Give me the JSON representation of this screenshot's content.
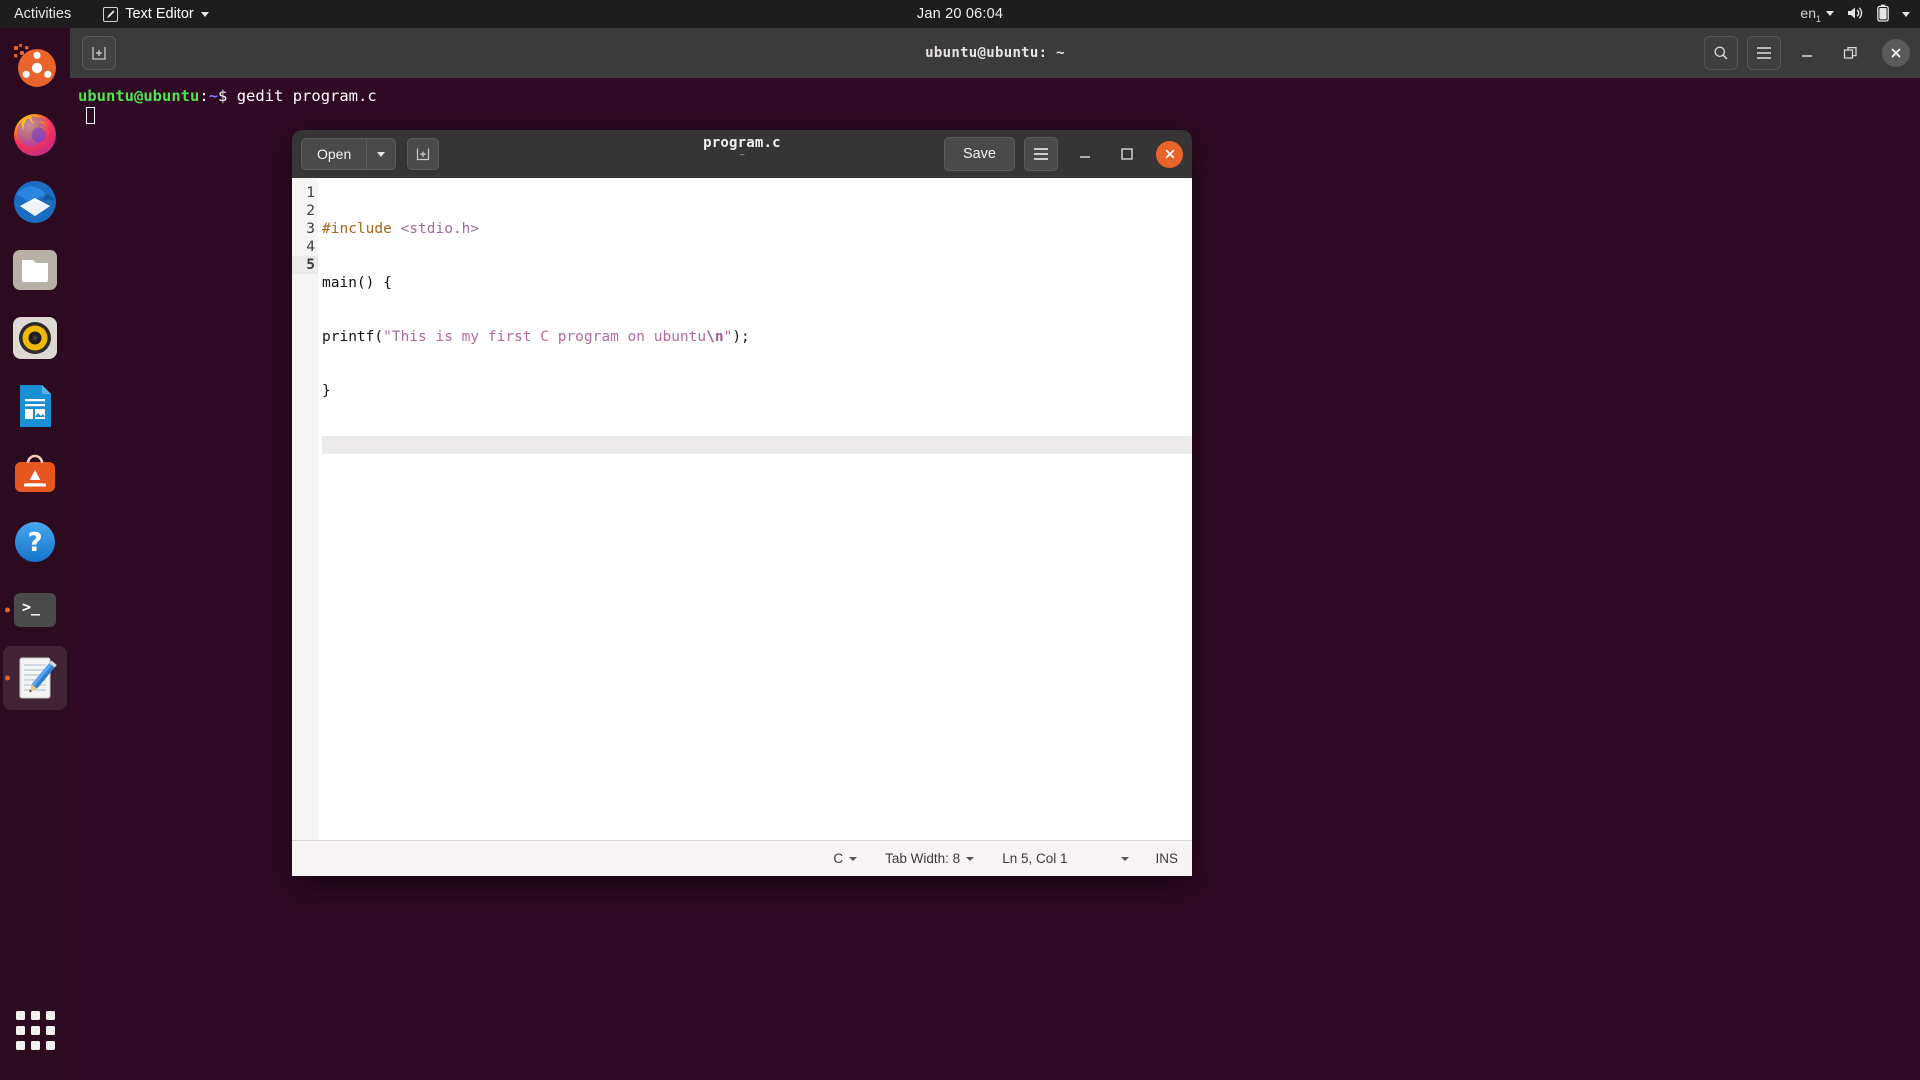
{
  "topbar": {
    "activities": "Activities",
    "app_name": "Text Editor",
    "clock": "Jan 20  06:04",
    "keyboard_layout": "en",
    "keyboard_sub": "1"
  },
  "dock": {
    "items": [
      {
        "name": "ubuntu-software-install",
        "label": "Install Ubuntu",
        "running": false,
        "active": false
      },
      {
        "name": "firefox",
        "label": "Firefox Web Browser",
        "running": false,
        "active": false
      },
      {
        "name": "thunderbird",
        "label": "Thunderbird Mail",
        "running": false,
        "active": false
      },
      {
        "name": "files",
        "label": "Files",
        "running": false,
        "active": false
      },
      {
        "name": "rhythmbox",
        "label": "Rhythmbox",
        "running": false,
        "active": false
      },
      {
        "name": "libreoffice-writer",
        "label": "LibreOffice Writer",
        "running": false,
        "active": false
      },
      {
        "name": "ubuntu-software",
        "label": "Ubuntu Software",
        "running": false,
        "active": false
      },
      {
        "name": "help",
        "label": "Help",
        "running": false,
        "active": false
      },
      {
        "name": "terminal",
        "label": "Terminal",
        "running": true,
        "active": false
      },
      {
        "name": "text-editor",
        "label": "Text Editor",
        "running": true,
        "active": true
      }
    ],
    "show_applications": "Show Applications"
  },
  "terminal": {
    "title": "ubuntu@ubuntu: ~",
    "prompt_user": "ubuntu@ubuntu",
    "prompt_colon": ":",
    "prompt_path": "~",
    "prompt_sigil": "$",
    "command": "gedit program.c"
  },
  "gedit": {
    "open_label": "Open",
    "title": "program.c",
    "subtitle": "~",
    "save_label": "Save",
    "document": {
      "lines": [
        {
          "number": "1",
          "current": false
        },
        {
          "number": "2",
          "current": false
        },
        {
          "number": "3",
          "current": false
        },
        {
          "number": "4",
          "current": false
        },
        {
          "number": "5",
          "current": true
        }
      ],
      "line1_pre": "#include",
      "line1_inc": " <stdio.h>",
      "line2": "main() {",
      "line3_a": "printf(",
      "line3_str": "\"This is my first C program on ubuntu",
      "line3_esc": "\\n",
      "line3_strend": "\"",
      "line3_b": ");",
      "line4": "}",
      "line5": ""
    },
    "status": {
      "language": "C",
      "tab_width": "Tab Width: 8",
      "position": "Ln 5, Col 1",
      "insert_mode": "INS"
    }
  },
  "colors": {
    "desktop_bg": "#300a24",
    "topbar_bg": "#1d1d1d",
    "dock_bg": "#2c0b20",
    "accent_orange": "#e8642a",
    "terminal_green": "#4ee44e",
    "terminal_blue": "#7a7aff",
    "header_dark": "#353535"
  }
}
